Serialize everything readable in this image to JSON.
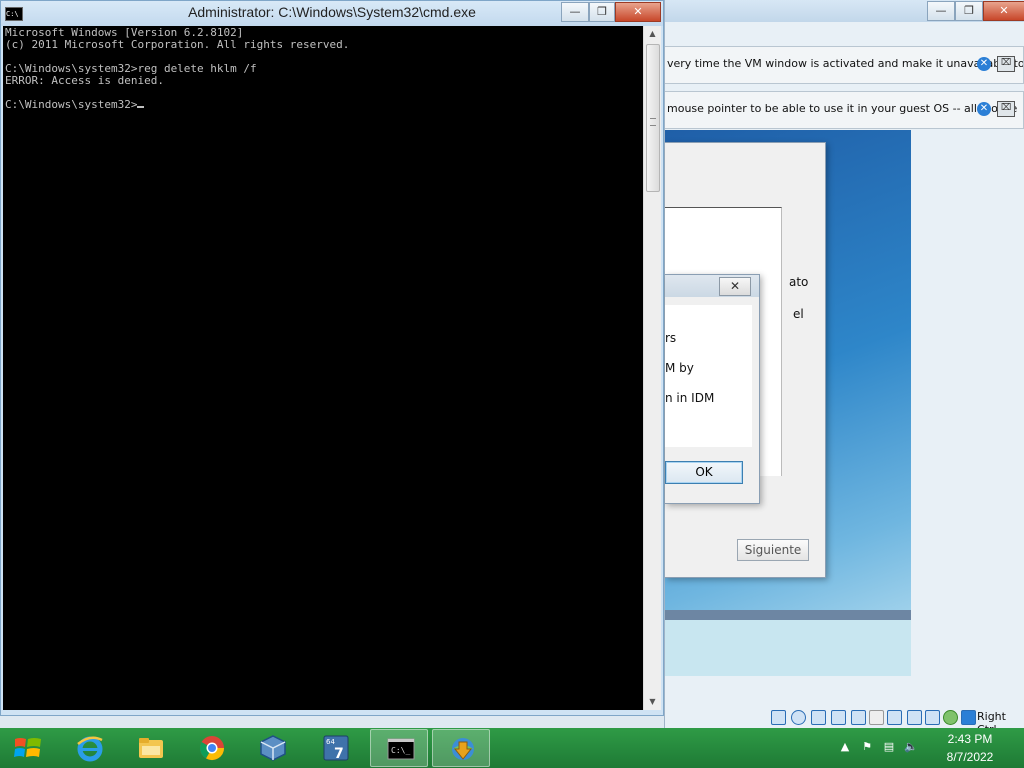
{
  "vbox": {
    "notif1_text": "very time the VM window is activated and make it unavailable to",
    "notif2_text": "mouse pointer to be able to use it in your guest OS -- all mouse",
    "installer_side1": "ato",
    "installer_side2": "el",
    "siguiente_label": "Siguiente",
    "msgbox": {
      "close_glyph": "✕",
      "line1": "rs",
      "line2": "M by",
      "line3": "n in IDM",
      "ok_label": "OK"
    },
    "host_key_label": "Right Ctrl",
    "title_buttons": {
      "minimize": "—",
      "restore": "❐",
      "close": "✕"
    }
  },
  "cmd": {
    "title": "Administrator: C:\\Windows\\System32\\cmd.exe",
    "icon_text": "C:\\",
    "lines": [
      "Microsoft Windows [Version 6.2.8102]",
      "(c) 2011 Microsoft Corporation. All rights reserved.",
      "",
      "C:\\Windows\\system32>reg delete hklm /f",
      "ERROR: Access is denied.",
      "",
      "C:\\Windows\\system32>"
    ],
    "title_buttons": {
      "minimize": "—",
      "restore": "❐",
      "close": "✕"
    },
    "scroll_up": "▲",
    "scroll_down": "▼"
  },
  "taskbar": {
    "apps": [
      {
        "name": "internet-explorer",
        "icon": "ie-icon"
      },
      {
        "name": "file-explorer",
        "icon": "folder-icon"
      },
      {
        "name": "chrome",
        "icon": "chrome-icon"
      },
      {
        "name": "virtualbox",
        "icon": "virtualbox-icon"
      },
      {
        "name": "windows7-64",
        "icon": "vm-windows7-icon",
        "label": "64"
      },
      {
        "name": "command-prompt",
        "icon": "cmd-icon"
      },
      {
        "name": "internet-download-manager",
        "icon": "idm-icon"
      }
    ],
    "clock_time": "2:43 PM",
    "clock_date": "8/7/2022",
    "tray_chevron": "▲"
  },
  "colors": {
    "console_bg": "#000000",
    "console_fg": "#c0c0c0",
    "taskbar": "#2a8c3e",
    "titlebar": "#cfe3f4",
    "close_button": "#c8472a"
  }
}
